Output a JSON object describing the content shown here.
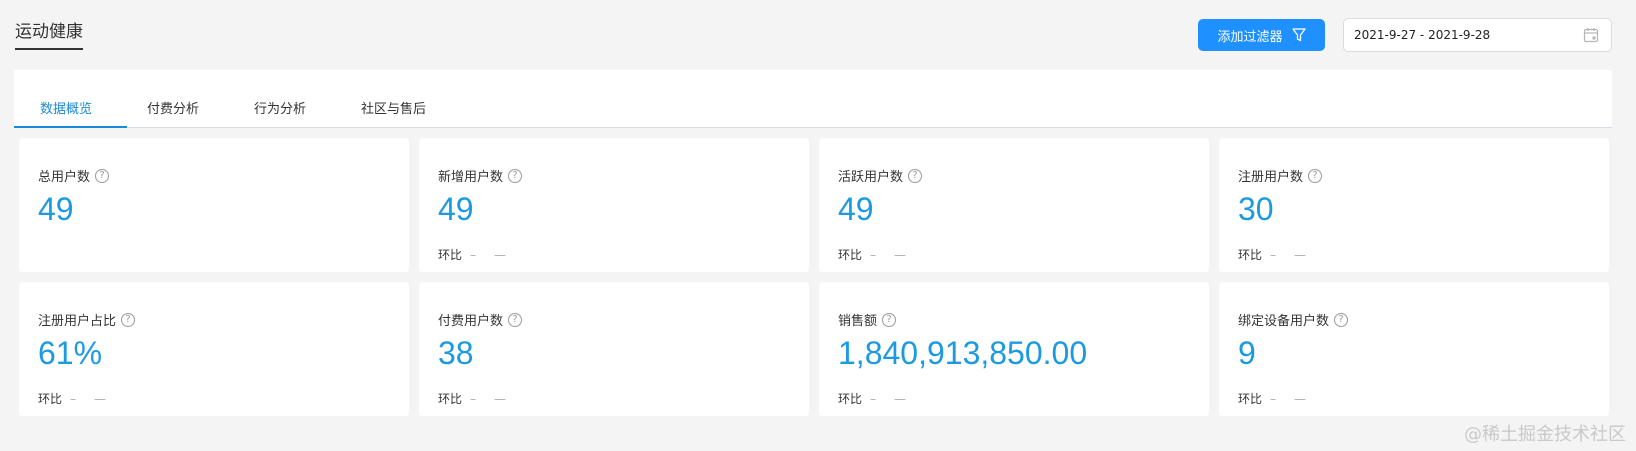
{
  "header": {
    "title": "运动健康",
    "filter_button": "添加过滤器",
    "date_range": "2021-9-27 - 2021-9-28"
  },
  "tabs": [
    {
      "label": "数据概览",
      "active": true
    },
    {
      "label": "付费分析",
      "active": false
    },
    {
      "label": "行为分析",
      "active": false
    },
    {
      "label": "社区与售后",
      "active": false
    }
  ],
  "cards": [
    {
      "label": "总用户数",
      "value": "49"
    },
    {
      "label": "新增用户数",
      "value": "49",
      "compare_label": "环比",
      "compare_a": "–",
      "compare_b": "—"
    },
    {
      "label": "活跃用户数",
      "value": "49",
      "compare_label": "环比",
      "compare_a": "–",
      "compare_b": "—"
    },
    {
      "label": "注册用户数",
      "value": "30",
      "compare_label": "环比",
      "compare_a": "–",
      "compare_b": "—"
    },
    {
      "label": "注册用户占比",
      "value": "61%",
      "compare_label": "环比",
      "compare_a": "–",
      "compare_b": "—"
    },
    {
      "label": "付费用户数",
      "value": "38",
      "compare_label": "环比",
      "compare_a": "–",
      "compare_b": "—"
    },
    {
      "label": "销售额",
      "value": "1,840,913,850.00",
      "compare_label": "环比",
      "compare_a": "–",
      "compare_b": "—"
    },
    {
      "label": "绑定设备用户数",
      "value": "9",
      "compare_label": "环比",
      "compare_a": "–",
      "compare_b": "—"
    }
  ],
  "help_glyph": "?",
  "watermark": "@稀土掘金技术社区",
  "colors": {
    "accent": "#1b9ae0",
    "button": "#1e90ff",
    "background": "#f4f4f4"
  }
}
